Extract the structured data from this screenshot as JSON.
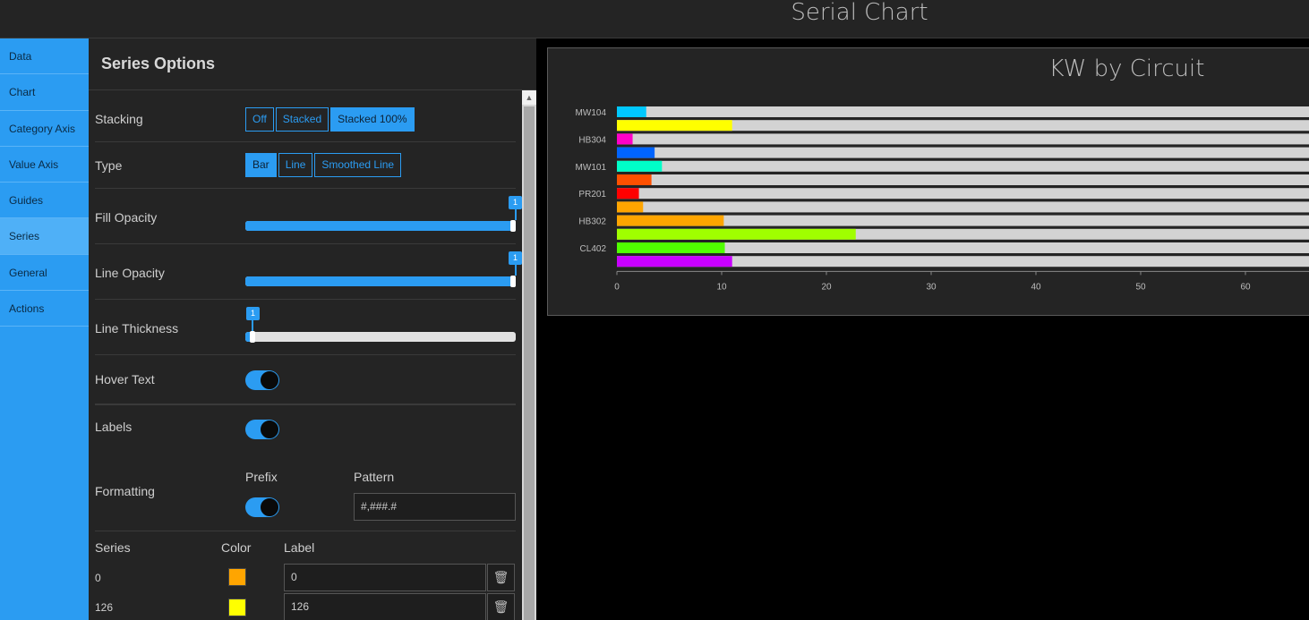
{
  "header": {
    "title": "Serial Chart"
  },
  "nav": {
    "items": [
      {
        "label": "Data"
      },
      {
        "label": "Chart"
      },
      {
        "label": "Category Axis"
      },
      {
        "label": "Value Axis"
      },
      {
        "label": "Guides"
      },
      {
        "label": "Series"
      },
      {
        "label": "General"
      },
      {
        "label": "Actions"
      }
    ],
    "active": "Series",
    "accent_color": "#2b9cf2"
  },
  "panel": {
    "title": "Series Options",
    "stacking": {
      "label": "Stacking",
      "options": [
        "Off",
        "Stacked",
        "Stacked 100%"
      ],
      "selected": "Stacked 100%"
    },
    "type": {
      "label": "Type",
      "options": [
        "Bar",
        "Line",
        "Smoothed Line"
      ],
      "selected": "Bar"
    },
    "fill_opacity": {
      "label": "Fill Opacity",
      "value": "1",
      "fraction": 1.0
    },
    "line_opacity": {
      "label": "Line Opacity",
      "value": "1",
      "fraction": 1.0
    },
    "line_thickness": {
      "label": "Line Thickness",
      "value": "1",
      "fraction": 0.0
    },
    "hover_text": {
      "label": "Hover Text",
      "on": true
    },
    "labels": {
      "label": "Labels",
      "on": true
    },
    "formatting": {
      "label": "Formatting",
      "prefix_label": "Prefix",
      "prefix_on": true,
      "pattern_label": "Pattern",
      "pattern_value": "#,###.#"
    },
    "series_table": {
      "headers": {
        "series": "Series",
        "color": "Color",
        "label": "Label"
      },
      "rows": [
        {
          "series": "0",
          "color": "#ffa500",
          "label": "0",
          "delete_icon": "trash-icon"
        },
        {
          "series": "126",
          "color": "#ffff00",
          "label": "126",
          "delete_icon": "trash-icon"
        }
      ]
    }
  },
  "chart_data": {
    "type": "bar",
    "title": "KW by Circuit",
    "orientation": "horizontal",
    "stacked": "100%",
    "background_bar_color": "#d3d3d3",
    "category_labels": [
      "MW104",
      "HB304",
      "MW101",
      "PR201",
      "HB302",
      "CL402"
    ],
    "bars": [
      {
        "value": 2.8,
        "color": "#00c8ff"
      },
      {
        "value": 11,
        "color": "#ffff00"
      },
      {
        "value": 1.5,
        "color": "#ff00c8"
      },
      {
        "value": 3.6,
        "color": "#0064ff"
      },
      {
        "value": 4.3,
        "color": "#00ffc8"
      },
      {
        "value": 3.3,
        "color": "#ff5000"
      },
      {
        "value": 2.1,
        "color": "#ff0000"
      },
      {
        "value": 2.5,
        "color": "#ffa500"
      },
      {
        "value": 10.2,
        "color": "#ffa500"
      },
      {
        "value": 22.8,
        "color": "#a0ff00"
      },
      {
        "value": 10.3,
        "color": "#50ff00"
      },
      {
        "value": 11,
        "color": "#c800ff"
      }
    ],
    "x_ticks": [
      "0",
      "10",
      "20",
      "30",
      "40",
      "50",
      "60"
    ],
    "xlim": [
      0,
      70
    ],
    "grid": false
  }
}
